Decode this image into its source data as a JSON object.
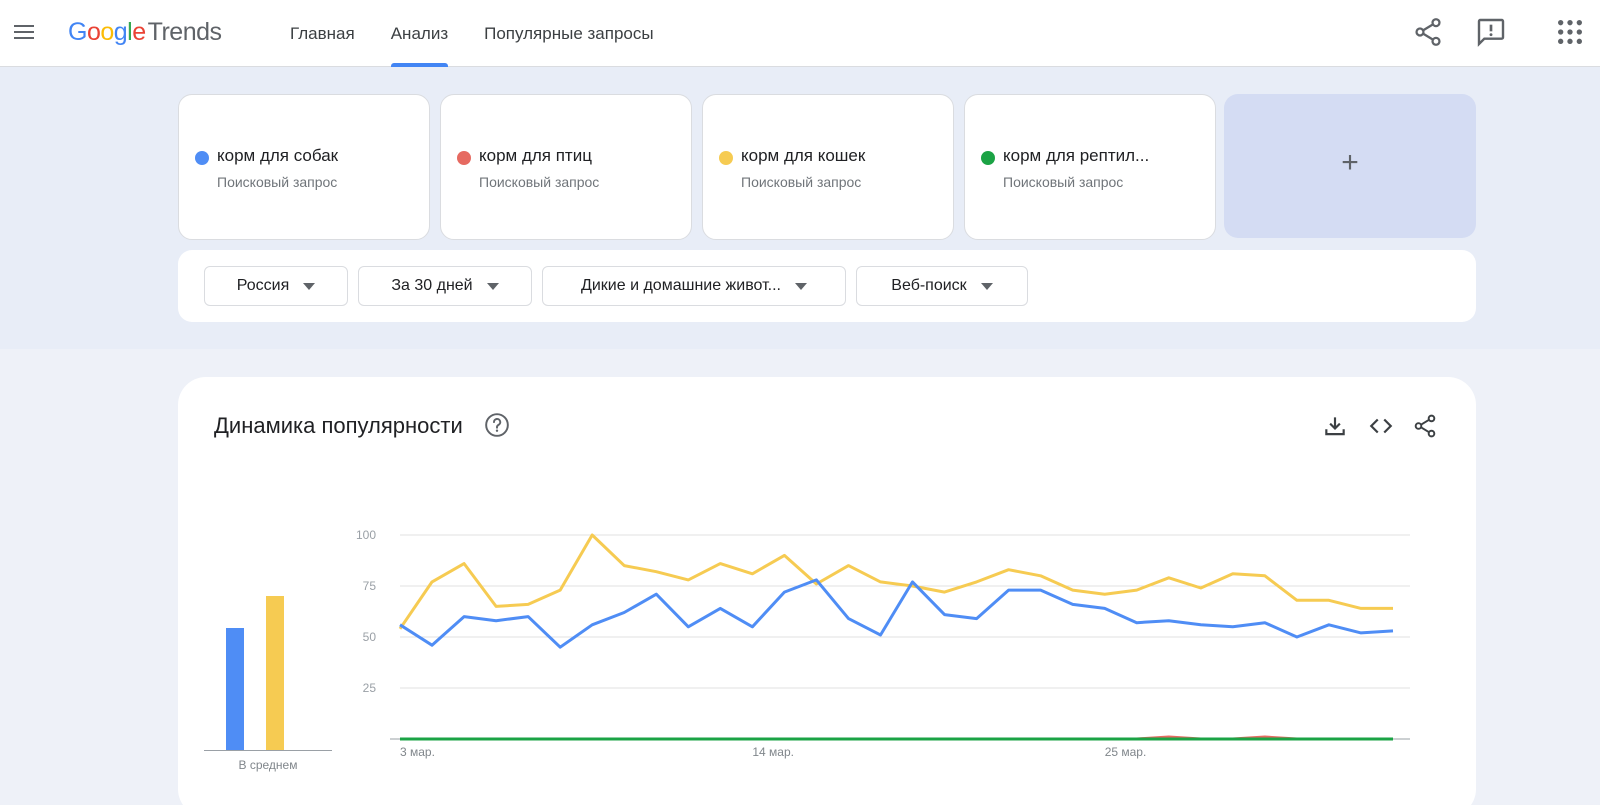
{
  "header": {
    "logo": [
      "G",
      "o",
      "o",
      "g",
      "l",
      "e"
    ],
    "logo_product": "Trends",
    "nav": [
      {
        "label": "Главная",
        "active": false
      },
      {
        "label": "Анализ",
        "active": true
      },
      {
        "label": "Популярные запросы",
        "active": false
      }
    ]
  },
  "terms": [
    {
      "name": "корм для собак",
      "type": "Поисковый запрос",
      "color": "#4f8df5"
    },
    {
      "name": "корм для птиц",
      "type": "Поисковый запрос",
      "color": "#e66a61"
    },
    {
      "name": "корм для кошек",
      "type": "Поисковый запрос",
      "color": "#f6cb52"
    },
    {
      "name": "корм для рептил...",
      "type": "Поисковый запрос",
      "color": "#1ba345"
    }
  ],
  "add_term": "+",
  "filters": {
    "region": "Россия",
    "period": "За 30 дней",
    "category": "Дикие и домашние живот...",
    "source": "Веб-поиск"
  },
  "chart": {
    "title": "Динамика популярности"
  },
  "chart_data": [
    {
      "type": "bar",
      "categories": [
        "корм для собак",
        "корм для кошек"
      ],
      "values": [
        60,
        76
      ],
      "xlabel": "В среднем",
      "colors": [
        "#4f8df5",
        "#f6cb52"
      ]
    },
    {
      "type": "line",
      "ylim": [
        0,
        100
      ],
      "yticks": [
        25,
        50,
        75,
        100
      ],
      "x_tick_labels": [
        {
          "label": "3 мар.",
          "index": 0
        },
        {
          "label": "14 мар.",
          "index": 11
        },
        {
          "label": "25 мар.",
          "index": 22
        }
      ],
      "grid": true,
      "series": [
        {
          "name": "корм для собак",
          "color": "#4f8df5",
          "values": [
            56,
            46,
            60,
            58,
            60,
            45,
            56,
            62,
            71,
            55,
            64,
            55,
            72,
            78,
            59,
            51,
            77,
            61,
            59,
            73,
            73,
            66,
            64,
            57,
            58,
            56,
            55,
            57,
            50,
            56,
            52,
            53
          ]
        },
        {
          "name": "корм для кошек",
          "color": "#f6cb52",
          "values": [
            54,
            77,
            86,
            65,
            66,
            73,
            100,
            85,
            82,
            78,
            86,
            81,
            90,
            76,
            85,
            77,
            75,
            72,
            77,
            83,
            80,
            73,
            71,
            73,
            79,
            74,
            81,
            80,
            68,
            68,
            64,
            64
          ]
        },
        {
          "name": "корм для птиц",
          "color": "#e66a61",
          "values": [
            0,
            0,
            0,
            0,
            0,
            0,
            0,
            0,
            0,
            0,
            0,
            0,
            0,
            0,
            0,
            0,
            0,
            0,
            0,
            0,
            0,
            0,
            0,
            0,
            1,
            0,
            0,
            1,
            0,
            0,
            0,
            0
          ]
        },
        {
          "name": "корм для рептил...",
          "color": "#1ba345",
          "values": [
            0,
            0,
            0,
            0,
            0,
            0,
            0,
            0,
            0,
            0,
            0,
            0,
            0,
            0,
            0,
            0,
            0,
            0,
            0,
            0,
            0,
            0,
            0,
            0,
            0,
            0,
            0,
            0,
            0,
            0,
            0,
            0
          ]
        }
      ]
    }
  ]
}
